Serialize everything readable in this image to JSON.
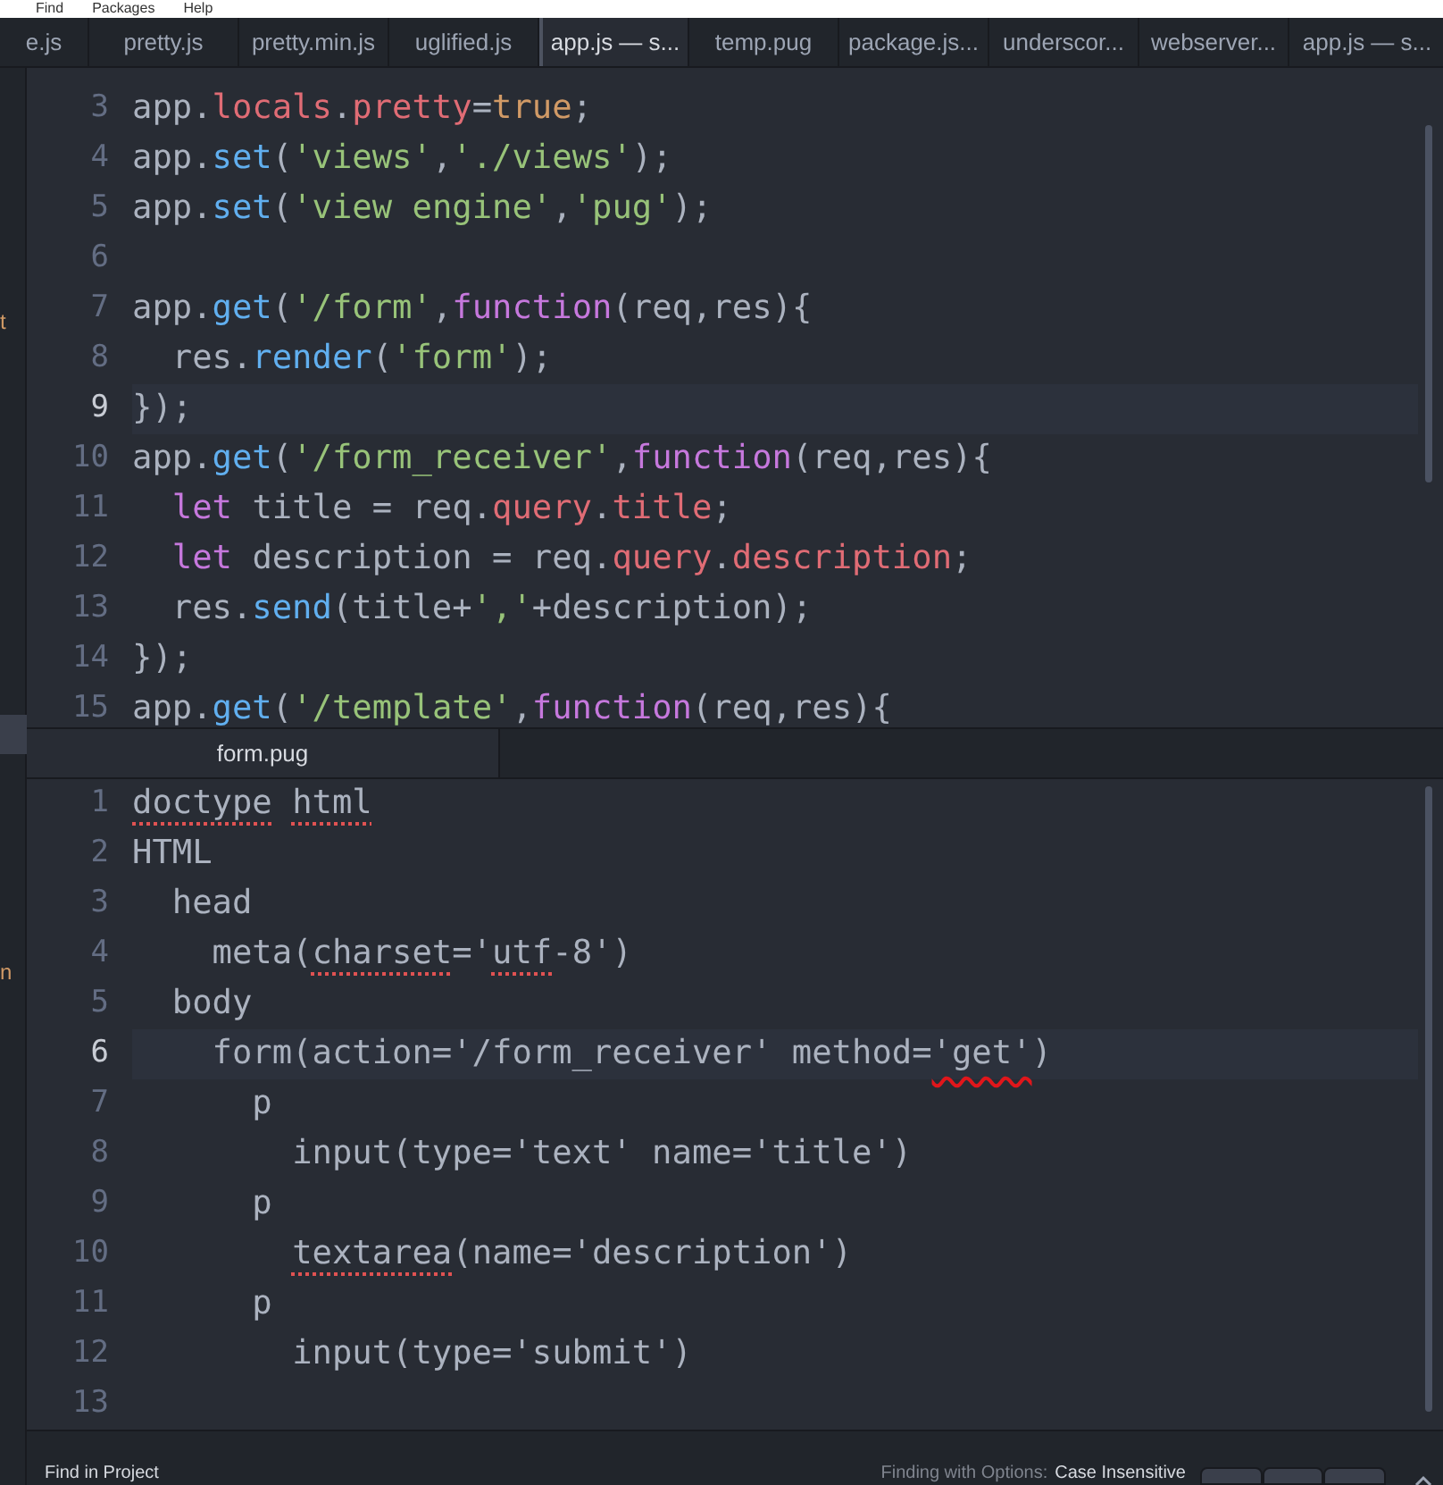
{
  "menu": [
    "Find",
    "Packages",
    "Help"
  ],
  "tabs": [
    {
      "label": "e.js",
      "selected": false
    },
    {
      "label": "pretty.js",
      "selected": false
    },
    {
      "label": "pretty.min.js",
      "selected": false
    },
    {
      "label": "uglified.js",
      "selected": false
    },
    {
      "label": "app.js — s...",
      "selected": true
    },
    {
      "label": "temp.pug",
      "selected": false
    },
    {
      "label": "package.js...",
      "selected": false
    },
    {
      "label": "underscor...",
      "selected": false
    },
    {
      "label": "webserver...",
      "selected": false
    },
    {
      "label": "app.js — s...",
      "selected": false
    }
  ],
  "sidebar": {
    "fragments": [
      "t",
      "n"
    ]
  },
  "editors": [
    {
      "lines": [
        {
          "number": "3",
          "cursor": false,
          "tokens": [
            {
              "text": "app.",
              "kind": "plain"
            },
            {
              "text": "locals",
              "kind": "prop"
            },
            {
              "text": ".",
              "kind": "plain"
            },
            {
              "text": "pretty",
              "kind": "prop"
            },
            {
              "text": "=",
              "kind": "plain"
            },
            {
              "text": "true",
              "kind": "const"
            },
            {
              "text": ";",
              "kind": "plain"
            }
          ]
        },
        {
          "number": "4",
          "cursor": false,
          "tokens": [
            {
              "text": "app.",
              "kind": "plain"
            },
            {
              "text": "set",
              "kind": "func"
            },
            {
              "text": "(",
              "kind": "plain"
            },
            {
              "text": "'views'",
              "kind": "str"
            },
            {
              "text": ",",
              "kind": "plain"
            },
            {
              "text": "'./views'",
              "kind": "str"
            },
            {
              "text": ");",
              "kind": "plain"
            }
          ]
        },
        {
          "number": "5",
          "cursor": false,
          "tokens": [
            {
              "text": "app.",
              "kind": "plain"
            },
            {
              "text": "set",
              "kind": "func"
            },
            {
              "text": "(",
              "kind": "plain"
            },
            {
              "text": "'view engine'",
              "kind": "str"
            },
            {
              "text": ",",
              "kind": "plain"
            },
            {
              "text": "'pug'",
              "kind": "str"
            },
            {
              "text": ");",
              "kind": "plain"
            }
          ]
        },
        {
          "number": "6",
          "cursor": false
        },
        {
          "number": "7",
          "cursor": false,
          "tokens": [
            {
              "text": "app.",
              "kind": "plain"
            },
            {
              "text": "get",
              "kind": "func"
            },
            {
              "text": "(",
              "kind": "plain"
            },
            {
              "text": "'/form'",
              "kind": "str"
            },
            {
              "text": ",",
              "kind": "plain"
            },
            {
              "text": "function",
              "kind": "kw"
            },
            {
              "text": "(req,res){",
              "kind": "plain"
            }
          ]
        },
        {
          "number": "8",
          "cursor": false,
          "tokens": [
            {
              "text": "  res.",
              "kind": "plain"
            },
            {
              "text": "render",
              "kind": "func"
            },
            {
              "text": "(",
              "kind": "plain"
            },
            {
              "text": "'form'",
              "kind": "str"
            },
            {
              "text": ");",
              "kind": "plain"
            }
          ]
        },
        {
          "number": "9",
          "cursor": true,
          "tokens": [
            {
              "text": "});",
              "kind": "plain"
            }
          ]
        },
        {
          "number": "10",
          "cursor": false,
          "tokens": [
            {
              "text": "app.",
              "kind": "plain"
            },
            {
              "text": "get",
              "kind": "func"
            },
            {
              "text": "(",
              "kind": "plain"
            },
            {
              "text": "'/form_receiver'",
              "kind": "str"
            },
            {
              "text": ",",
              "kind": "plain"
            },
            {
              "text": "function",
              "kind": "kw"
            },
            {
              "text": "(req,res){",
              "kind": "plain"
            }
          ]
        },
        {
          "number": "11",
          "cursor": false,
          "tokens": [
            {
              "text": "  let",
              "kind": "kw"
            },
            {
              "text": " title = req.",
              "kind": "plain"
            },
            {
              "text": "query",
              "kind": "prop"
            },
            {
              "text": ".",
              "kind": "plain"
            },
            {
              "text": "title",
              "kind": "prop"
            },
            {
              "text": ";",
              "kind": "plain"
            }
          ]
        },
        {
          "number": "12",
          "cursor": false,
          "tokens": [
            {
              "text": "  let",
              "kind": "kw"
            },
            {
              "text": " description = req.",
              "kind": "plain"
            },
            {
              "text": "query",
              "kind": "prop"
            },
            {
              "text": ".",
              "kind": "plain"
            },
            {
              "text": "description",
              "kind": "prop"
            },
            {
              "text": ";",
              "kind": "plain"
            }
          ]
        },
        {
          "number": "13",
          "cursor": false,
          "tokens": [
            {
              "text": "  res.",
              "kind": "plain"
            },
            {
              "text": "send",
              "kind": "func"
            },
            {
              "text": "(title+",
              "kind": "plain"
            },
            {
              "text": "','",
              "kind": "str"
            },
            {
              "text": "+description);",
              "kind": "plain"
            }
          ]
        },
        {
          "number": "14",
          "cursor": false,
          "tokens": [
            {
              "text": "});",
              "kind": "plain"
            }
          ]
        },
        {
          "number": "15",
          "cursor": false,
          "tokens": [
            {
              "text": "app.",
              "kind": "plain"
            },
            {
              "text": "get",
              "kind": "func"
            },
            {
              "text": "(",
              "kind": "plain"
            },
            {
              "text": "'/template'",
              "kind": "str"
            },
            {
              "text": ",",
              "kind": "plain"
            },
            {
              "text": "function",
              "kind": "kw"
            },
            {
              "text": "(req,res){",
              "kind": "plain"
            }
          ]
        }
      ]
    },
    {
      "tab": {
        "label": "form.pug",
        "selected": true
      },
      "lines": [
        {
          "number": "1",
          "cursor": false,
          "tokens": [
            {
              "text": "doctype",
              "kind": "plain",
              "spell": true
            },
            {
              "text": " html",
              "kind": "plain",
              "spell": true
            }
          ]
        },
        {
          "number": "2",
          "cursor": false,
          "tokens": [
            {
              "text": "HTML",
              "kind": "plain"
            }
          ]
        },
        {
          "number": "3",
          "cursor": false,
          "tokens": [
            {
              "text": "  head",
              "kind": "plain"
            }
          ]
        },
        {
          "number": "4",
          "cursor": false,
          "tokens": [
            {
              "text": "    meta(",
              "kind": "plain"
            },
            {
              "text": "charset",
              "kind": "plain",
              "spell": true
            },
            {
              "text": "='",
              "kind": "plain"
            },
            {
              "text": "utf",
              "kind": "plain",
              "spell": true
            },
            {
              "text": "-8')",
              "kind": "plain"
            }
          ]
        },
        {
          "number": "5",
          "cursor": false,
          "tokens": [
            {
              "text": "  body",
              "kind": "plain"
            }
          ]
        },
        {
          "number": "6",
          "cursor": true,
          "tokens": [
            {
              "text": "    form(action='/form_receiver' method=",
              "kind": "plain"
            },
            {
              "text": "'get'",
              "kind": "plain",
              "annotated": true
            },
            {
              "text": ")",
              "kind": "plain"
            }
          ]
        },
        {
          "number": "7",
          "cursor": false,
          "tokens": [
            {
              "text": "      p",
              "kind": "plain"
            }
          ]
        },
        {
          "number": "8",
          "cursor": false,
          "tokens": [
            {
              "text": "        input(type='text' name='title')",
              "kind": "plain"
            }
          ]
        },
        {
          "number": "9",
          "cursor": false,
          "tokens": [
            {
              "text": "      p",
              "kind": "plain"
            }
          ]
        },
        {
          "number": "10",
          "cursor": false,
          "tokens": [
            {
              "text": "        textarea",
              "kind": "plain",
              "spell": true
            },
            {
              "text": "(name='description')",
              "kind": "plain"
            }
          ]
        },
        {
          "number": "11",
          "cursor": false,
          "tokens": [
            {
              "text": "      p",
              "kind": "plain"
            }
          ]
        },
        {
          "number": "12",
          "cursor": false,
          "tokens": [
            {
              "text": "        input(type='submit')",
              "kind": "plain"
            }
          ]
        },
        {
          "number": "13",
          "cursor": false
        }
      ]
    }
  ],
  "footer": {
    "title": "Find in Project",
    "options_label": "Finding with Options:",
    "options_value": "Case Insensitive"
  }
}
